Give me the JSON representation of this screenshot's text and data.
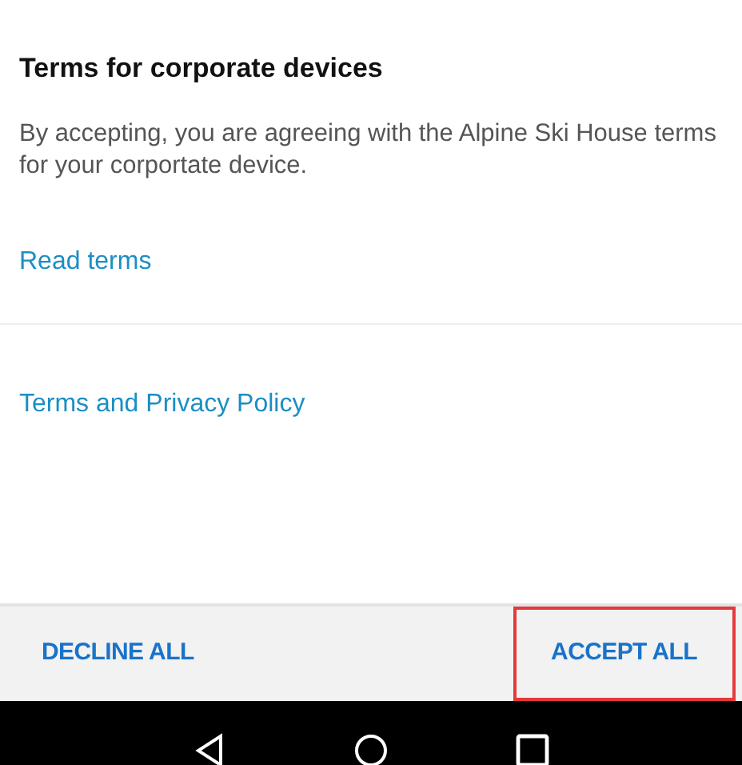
{
  "title": "Terms for corporate devices",
  "body": "By accepting, you are agreeing with the Alpine Ski House terms for your corportate device.",
  "links": [
    {
      "label": "Read terms"
    },
    {
      "label": "Terms and Privacy Policy"
    }
  ],
  "footer_buttons": [
    {
      "label": "DECLINE ALL",
      "highlighted": false
    },
    {
      "label": "ACCEPT ALL",
      "highlighted": true
    }
  ],
  "nav_bar": [
    {
      "kind": "back"
    },
    {
      "kind": "home"
    },
    {
      "kind": "recents"
    }
  ]
}
